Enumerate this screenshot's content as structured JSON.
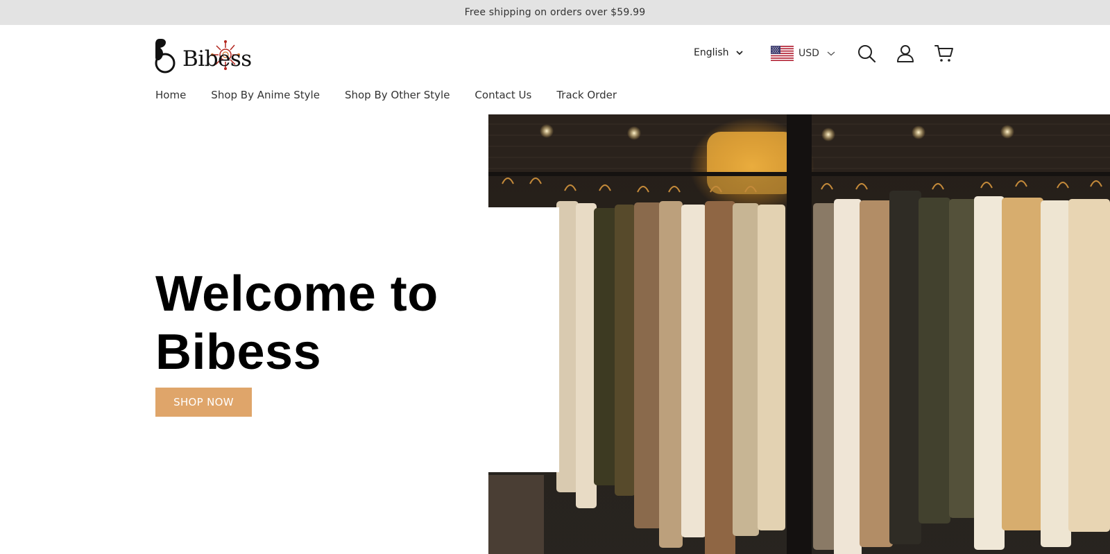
{
  "announcement": {
    "text": "Free shipping on orders over $59.99"
  },
  "header": {
    "logo_text": "Bibess",
    "language": {
      "selected": "English"
    },
    "currency": {
      "selected": "USD"
    },
    "icons": [
      "search-icon",
      "account-icon",
      "cart-icon"
    ]
  },
  "nav": {
    "items": [
      {
        "label": "Home"
      },
      {
        "label": "Shop By Anime Style"
      },
      {
        "label": "Shop By Other Style"
      },
      {
        "label": "Contact Us"
      },
      {
        "label": "Track Order"
      }
    ]
  },
  "hero": {
    "title_line1": "Welcome to",
    "title_line2": "Bibess",
    "button_label": "SHOP NOW",
    "image_subject": "clothing-rack-photo"
  },
  "colors": {
    "accent": "#dfa56a",
    "announcement_bg": "#e3e3e3"
  }
}
